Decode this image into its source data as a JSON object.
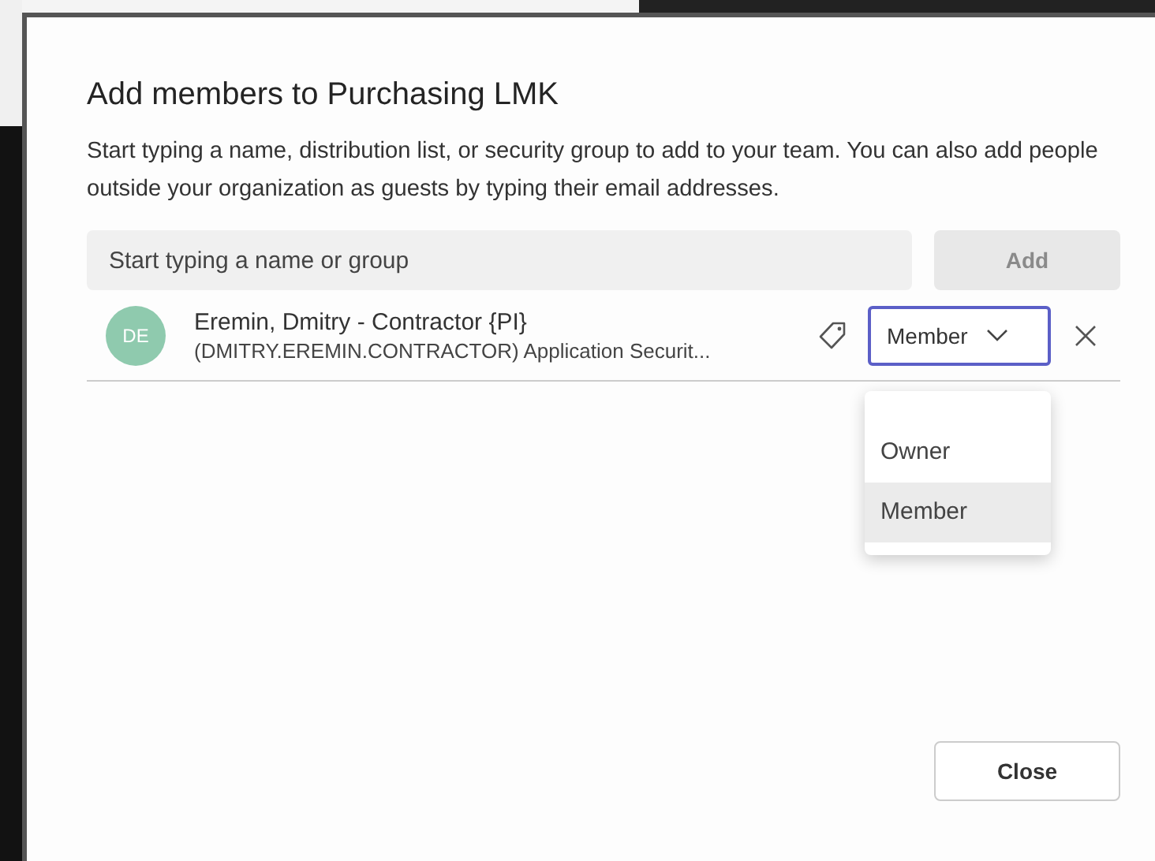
{
  "dialog": {
    "title": "Add members to Purchasing LMK",
    "description": "Start typing a name, distribution list, or security group to add to your team. You can also add people outside your organization as guests by typing their email addresses.",
    "search": {
      "placeholder": "Start typing a name or group"
    },
    "add_button": {
      "label": "Add",
      "disabled": true
    },
    "members": [
      {
        "initials": "DE",
        "color": "#8fcaae",
        "name": "Eremin, Dmitry - Contractor {PI}",
        "detail": "(DMITRY.EREMIN.CONTRACTOR) Application Securit...",
        "role": "Member",
        "menu_open": true
      }
    ],
    "role_menu": [
      {
        "label": "Owner",
        "selected": false
      },
      {
        "label": "Member",
        "selected": true
      }
    ],
    "close_button": "Close"
  }
}
